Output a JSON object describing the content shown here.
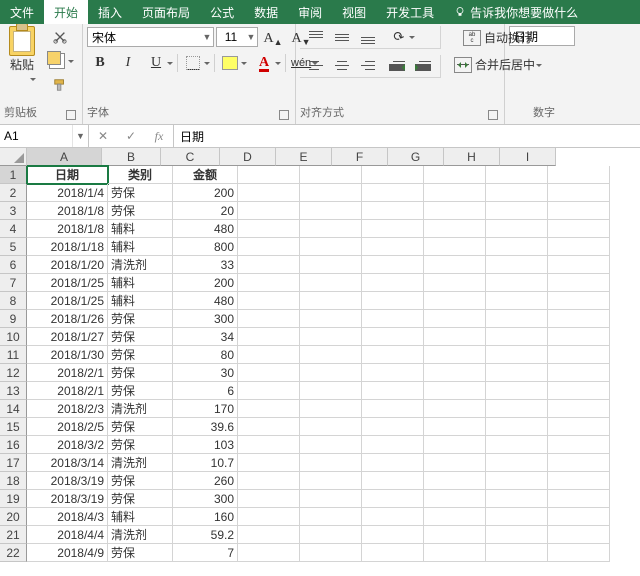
{
  "tabs": {
    "file": "文件",
    "home": "开始",
    "insert": "插入",
    "layout": "页面布局",
    "formulas": "公式",
    "data": "数据",
    "review": "审阅",
    "view": "视图",
    "dev": "开发工具",
    "tellme": "告诉我你想要做什么"
  },
  "ribbon": {
    "clipboard": {
      "paste": "粘贴",
      "group_label": "剪贴板"
    },
    "font": {
      "name": "宋体",
      "size": "11",
      "group_label": "字体",
      "bold": "B",
      "italic": "I",
      "underline": "U",
      "pinyin": "wén",
      "ainc": "A",
      "adec": "A",
      "fontA": "A"
    },
    "align": {
      "wrap": "自动换行",
      "merge": "合并后居中",
      "group_label": "对齐方式"
    },
    "number": {
      "format": "日期",
      "group_label": "数字"
    }
  },
  "fx": {
    "namebox": "A1",
    "fx_label": "fx",
    "cancel": "✕",
    "confirm": "✓",
    "formula": "日期"
  },
  "columns": [
    "A",
    "B",
    "C",
    "D",
    "E",
    "F",
    "G",
    "H",
    "I"
  ],
  "headers": {
    "c1": "日期",
    "c2": "类别",
    "c3": "金额"
  },
  "chart_data": {
    "type": "table",
    "columns": [
      "日期",
      "类别",
      "金额"
    ],
    "rows": [
      {
        "日期": "2018/1/4",
        "类别": "劳保",
        "金额": 200
      },
      {
        "日期": "2018/1/8",
        "类别": "劳保",
        "金额": 20
      },
      {
        "日期": "2018/1/8",
        "类别": "辅料",
        "金额": 480
      },
      {
        "日期": "2018/1/18",
        "类别": "辅料",
        "金额": 800
      },
      {
        "日期": "2018/1/20",
        "类别": "清洗剂",
        "金额": 33
      },
      {
        "日期": "2018/1/25",
        "类别": "辅料",
        "金额": 200
      },
      {
        "日期": "2018/1/25",
        "类别": "辅料",
        "金额": 480
      },
      {
        "日期": "2018/1/26",
        "类别": "劳保",
        "金额": 300
      },
      {
        "日期": "2018/1/27",
        "类别": "劳保",
        "金额": 34
      },
      {
        "日期": "2018/1/30",
        "类别": "劳保",
        "金额": 80
      },
      {
        "日期": "2018/2/1",
        "类别": "劳保",
        "金额": 30
      },
      {
        "日期": "2018/2/1",
        "类别": "劳保",
        "金额": 6
      },
      {
        "日期": "2018/2/3",
        "类别": "清洗剂",
        "金额": 170
      },
      {
        "日期": "2018/2/5",
        "类别": "劳保",
        "金额": 39.6
      },
      {
        "日期": "2018/3/2",
        "类别": "劳保",
        "金额": 103
      },
      {
        "日期": "2018/3/14",
        "类别": "清洗剂",
        "金额": 10.7
      },
      {
        "日期": "2018/3/19",
        "类别": "劳保",
        "金额": 260
      },
      {
        "日期": "2018/3/19",
        "类别": "劳保",
        "金额": 300
      },
      {
        "日期": "2018/4/3",
        "类别": "辅料",
        "金额": 160
      },
      {
        "日期": "2018/4/4",
        "类别": "清洗剂",
        "金额": 59.2
      },
      {
        "日期": "2018/4/9",
        "类别": "劳保",
        "金额": 7
      }
    ]
  }
}
